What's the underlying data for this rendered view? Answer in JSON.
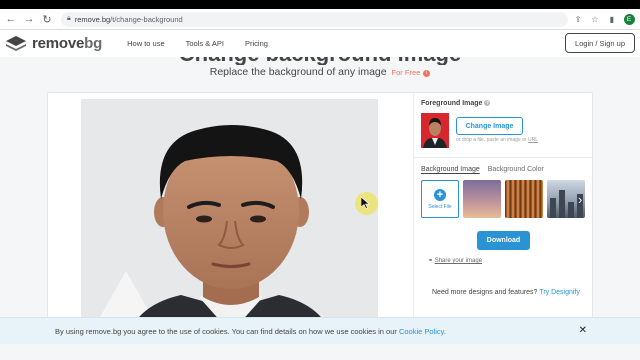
{
  "browser": {
    "url_host": "remove.bg",
    "url_path": "/t/change-background",
    "profile_initial": "E",
    "icons": {
      "back": "back-arrow-icon",
      "forward": "forward-arrow-icon",
      "reload": "reload-icon",
      "lock": "lock-icon",
      "share": "share-icon",
      "star": "star-icon",
      "sidebar": "sidebar-icon"
    }
  },
  "header": {
    "brand_part1": "remove",
    "brand_part2": "bg",
    "nav": [
      "How to use",
      "Tools & API",
      "Pricing"
    ],
    "login_label": "Login / Sign up"
  },
  "hero": {
    "title": "Change background image",
    "subtitle": "Replace the background of any image",
    "free_label": "For Free",
    "info_glyph": "i"
  },
  "panel": {
    "foreground_label": "Foreground Image",
    "help_glyph": "?",
    "change_image_label": "Change Image",
    "drop_hint_pre": "or drop a file, paste an image or ",
    "drop_hint_url": "URL",
    "tabs": [
      "Background Image",
      "Background Color"
    ],
    "active_tab": 0,
    "select_file_label": "Select File",
    "plus_glyph": "+",
    "next_glyph": "›",
    "download_label": "Download",
    "share_label": "Share your image",
    "need_more": "Need more designs and features?",
    "try_label": "Try Designify"
  },
  "cookie": {
    "message": "By using remove.bg you agree to the use of cookies. You can find details on how we use cookies in our ",
    "policy_link": "Cookie Policy",
    "period": ".",
    "close_glyph": "✕"
  },
  "colors": {
    "accent": "#2a93d6",
    "free": "#f2745f",
    "thumb_background": "#d8262e",
    "cursor_highlight": "#f0e028"
  }
}
